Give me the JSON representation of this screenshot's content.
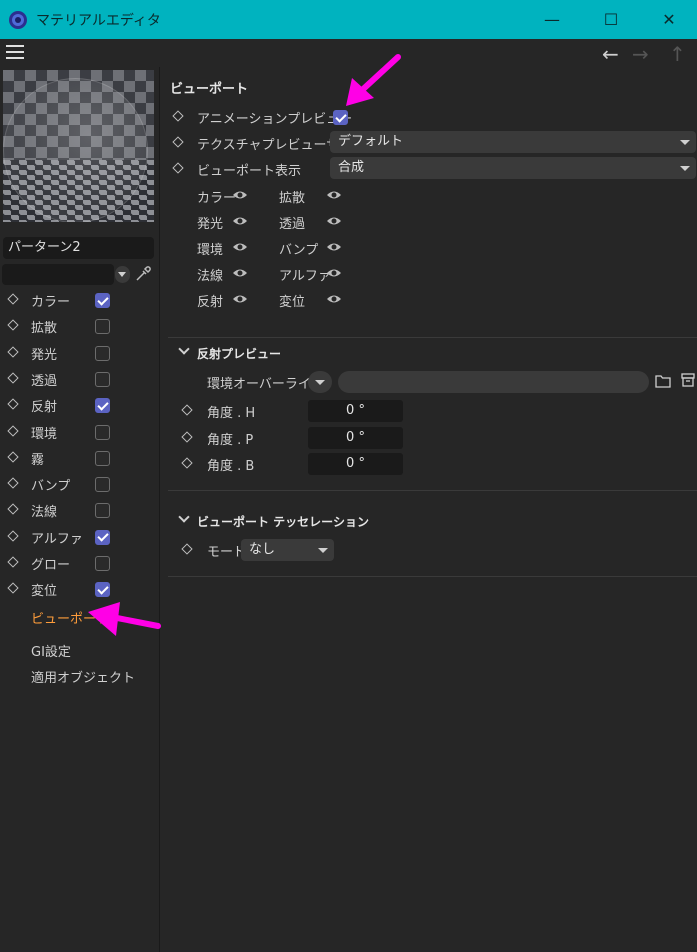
{
  "window": {
    "title": "マテリアルエディタ",
    "minimize": "—",
    "maximize": "☐",
    "close": "✕"
  },
  "toolbar": {
    "back": "←",
    "forward": "→",
    "up": "↑"
  },
  "left": {
    "material_name": "パーターン2",
    "channels": [
      {
        "label": "カラー",
        "checked": true
      },
      {
        "label": "拡散",
        "checked": false
      },
      {
        "label": "発光",
        "checked": false
      },
      {
        "label": "透過",
        "checked": false
      },
      {
        "label": "反射",
        "checked": true
      },
      {
        "label": "環境",
        "checked": false
      },
      {
        "label": "霧",
        "checked": false
      },
      {
        "label": "バンプ",
        "checked": false
      },
      {
        "label": "法線",
        "checked": false
      },
      {
        "label": "アルファ",
        "checked": true
      },
      {
        "label": "グロー",
        "checked": false
      },
      {
        "label": "変位",
        "checked": true
      }
    ],
    "extra": [
      "ビューポート",
      "GI設定",
      "適用オブジェクト"
    ]
  },
  "viewport": {
    "title": "ビューポート",
    "anim_preview_label": "アニメーションプレビュー",
    "anim_preview_checked": true,
    "tex_size_label": "テクスチャプレビューサイズ",
    "tex_size_value": "デフォルト",
    "display_label": "ビューポート表示",
    "display_value": "合成",
    "visibility": [
      "カラー",
      "拡散",
      "発光",
      "透過",
      "環境",
      "バンプ",
      "法線",
      "アルファ",
      "反射",
      "変位"
    ]
  },
  "reflection": {
    "title": "反射プレビュー",
    "env_override_label": "環境オーバーライド",
    "angles": [
      {
        "label": "角度 . H",
        "value": "0 °"
      },
      {
        "label": "角度 . P",
        "value": "0 °"
      },
      {
        "label": "角度 . B",
        "value": "0 °"
      }
    ]
  },
  "tessellation": {
    "title": "ビューポート テッセレーション",
    "mode_label": "モード",
    "mode_value": "なし"
  },
  "colors": {
    "titlebar": "#00b3bf",
    "accent_check": "#5b63c2",
    "active_text": "#ff9d3b",
    "annotation": "#ff00e6"
  }
}
